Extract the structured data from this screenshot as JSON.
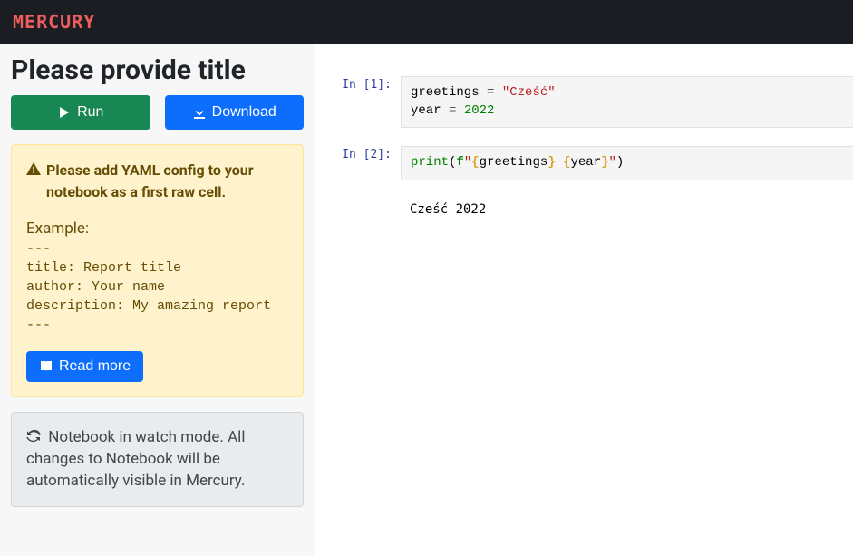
{
  "header": {
    "logo": "MERCURY"
  },
  "sidebar": {
    "title": "Please provide title",
    "run_label": "Run",
    "download_label": "Download",
    "warning": {
      "heading": "Please add YAML config to your notebook as a first raw cell.",
      "example_label": "Example:",
      "example_code": "---\ntitle: Report title\nauthor: Your name\ndescription: My amazing report\n---",
      "read_more_label": "Read more"
    },
    "watch_text": "Notebook in watch mode. All changes to Notebook will be automatically visible in Mercury."
  },
  "cells": [
    {
      "prompt": "In [1]:",
      "tokens": [
        {
          "t": "greetings",
          "c": "name"
        },
        {
          "t": " "
        },
        {
          "t": "=",
          "c": "op"
        },
        {
          "t": " "
        },
        {
          "t": "\"Cześć\"",
          "c": "str"
        },
        {
          "t": "\n"
        },
        {
          "t": "year",
          "c": "name"
        },
        {
          "t": " "
        },
        {
          "t": "=",
          "c": "op"
        },
        {
          "t": " "
        },
        {
          "t": "2022",
          "c": "num"
        }
      ],
      "output": null
    },
    {
      "prompt": "In [2]:",
      "tokens": [
        {
          "t": "print",
          "c": "builtin"
        },
        {
          "t": "(",
          "c": "punc"
        },
        {
          "t": "f",
          "c": "kw"
        },
        {
          "t": "\"",
          "c": "str"
        },
        {
          "t": "{",
          "c": "brace"
        },
        {
          "t": "greetings",
          "c": "name"
        },
        {
          "t": "}",
          "c": "brace"
        },
        {
          "t": " ",
          "c": "str"
        },
        {
          "t": "{",
          "c": "brace"
        },
        {
          "t": "year",
          "c": "name"
        },
        {
          "t": "}",
          "c": "brace"
        },
        {
          "t": "\"",
          "c": "str"
        },
        {
          "t": ")",
          "c": "punc"
        }
      ],
      "output": "Cześć 2022"
    }
  ]
}
